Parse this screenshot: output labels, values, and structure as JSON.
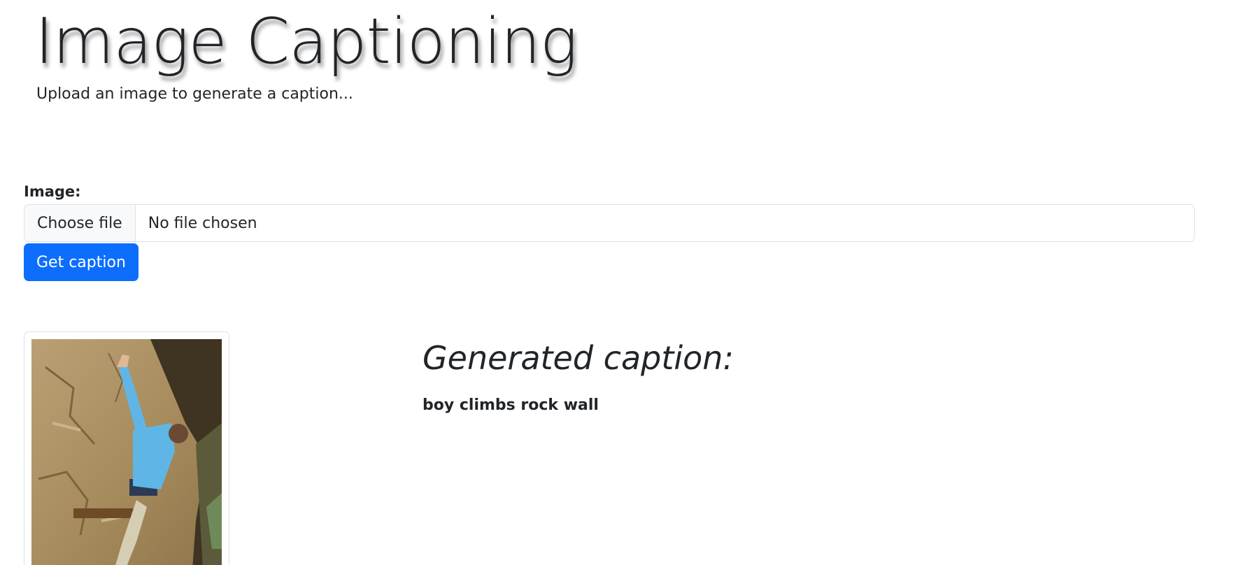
{
  "header": {
    "title": "Image Captioning",
    "subtitle": "Upload an image to generate a caption..."
  },
  "form": {
    "image_label": "Image:",
    "file_button_label": "Choose file",
    "file_status": "No file chosen",
    "submit_label": "Get caption"
  },
  "result": {
    "heading": "Generated caption:",
    "caption": "boy climbs rock wall"
  },
  "colors": {
    "primary": "#0d6efd",
    "text": "#212529",
    "border": "#dee2e6"
  }
}
